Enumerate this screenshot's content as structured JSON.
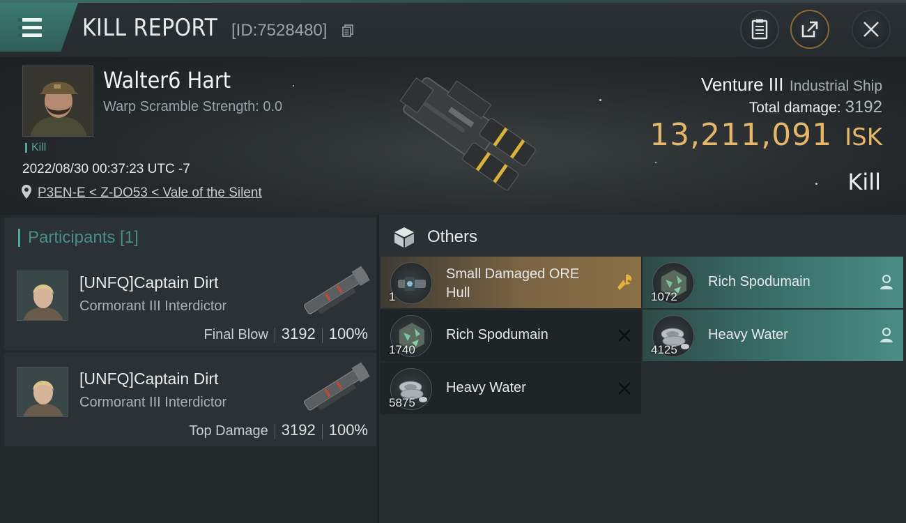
{
  "header": {
    "title": "KILL REPORT",
    "report_id": "[ID:7528480]"
  },
  "victim": {
    "name": "Walter6 Hart",
    "warp_scramble": "Warp Scramble Strength: 0.0",
    "tag": "Kill",
    "timestamp": "2022/08/30 00:37:23 UTC -7",
    "location": "P3EN-E < Z-DO53 < Vale of the Silent",
    "ship_name": "Venture III",
    "ship_class": "Industrial Ship",
    "total_damage_label": "Total damage:",
    "total_damage": "3192",
    "isk_value": "13,211,091",
    "isk_unit": "ISK",
    "result": "Kill"
  },
  "participants": {
    "label": "Participants [1]",
    "items": [
      {
        "name": "[UNFQ]Captain Dirt",
        "ship": "Cormorant III Interdictor",
        "role": "Final Blow",
        "damage": "3192",
        "percent": "100%"
      },
      {
        "name": "[UNFQ]Captain Dirt",
        "ship": "Cormorant III Interdictor",
        "role": "Top Damage",
        "damage": "3192",
        "percent": "100%"
      }
    ]
  },
  "others": {
    "label": "Others",
    "items": [
      {
        "name": "Small Damaged ORE Hull",
        "qty": "1",
        "status": "wrench-icon",
        "tint": "gold"
      },
      {
        "name": "Rich Spodumain",
        "qty": "1072",
        "status": "person-icon",
        "tint": "teal"
      },
      {
        "name": "Rich Spodumain",
        "qty": "1740",
        "status": "cross-icon",
        "tint": "dark"
      },
      {
        "name": "Heavy Water",
        "qty": "4125",
        "status": "person-icon",
        "tint": "teal"
      },
      {
        "name": "Heavy Water",
        "qty": "5875",
        "status": "cross-icon",
        "tint": "dark"
      }
    ]
  },
  "colors": {
    "isk": "#e6b768",
    "accent_teal": "#4fa79b",
    "dropped_tint": "#3b726b",
    "highlight_gold": "#7a6442"
  }
}
